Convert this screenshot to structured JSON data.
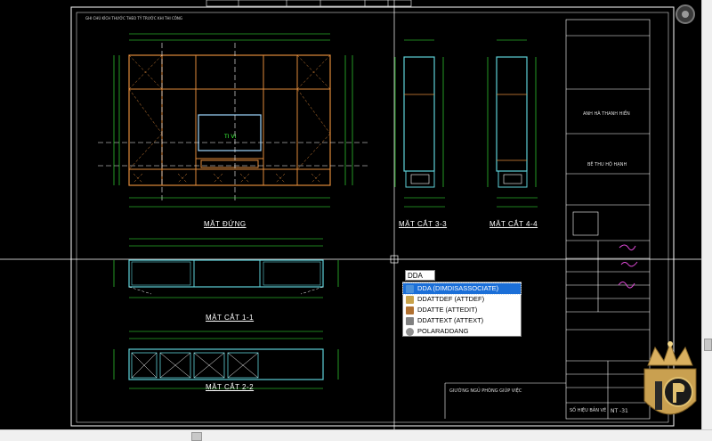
{
  "drawing": {
    "views": {
      "elevation": "MẶT ĐỨNG",
      "section_3": "MẶT CẮT 3-3",
      "section_4": "MẶT CẮT 4-4",
      "section_1": "MẶT CẮT 1-1",
      "section_2": "MẶT CẮT 2-2"
    },
    "notes_title": "GHI CHÚ KÍCH THƯỚC THEO TỶ TRƯỚC KHI THI CÔNG",
    "title_block": {
      "company": "ANH HÀ THANH HIỀN",
      "project": "BÊ THU HỘ HẠNH",
      "sheet_label": "SỐ HIỆU BẢN VẼ",
      "sheet_no": "NT -31",
      "bottom_title": "GIƯỜNG NGỦ PHÒNG GIÚP VIỆC"
    },
    "tv_label": "TI VI"
  },
  "autocomplete": {
    "input_value": "DDA",
    "items": [
      {
        "label": "DDA (DIMDISASSOCIATE)",
        "selected": true,
        "icon_color": "#4a90d9"
      },
      {
        "label": "DDATTDEF (ATTDEF)",
        "selected": false,
        "icon_color": "#c8a24a"
      },
      {
        "label": "DDATTE (ATTEDIT)",
        "selected": false,
        "icon_color": "#b07030"
      },
      {
        "label": "DDATTEXT (ATTEXT)",
        "selected": false,
        "icon_color": "#808080"
      },
      {
        "label": "POLARADDANG",
        "selected": false,
        "icon_color": "#909090"
      }
    ]
  },
  "colors": {
    "cabinet_outline": "#e08a3a",
    "section_outline": "#5ed0d8",
    "dimension": "#3cff3c",
    "frame": "#ffffff",
    "crosshair": "#ffffff"
  }
}
